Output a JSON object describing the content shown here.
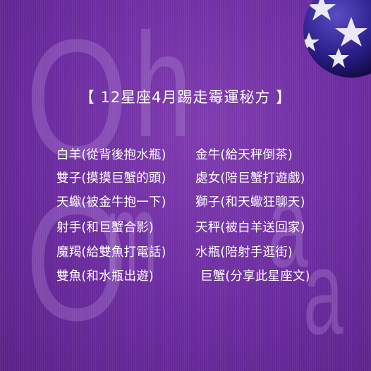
{
  "title": "【 12星座4月踢走霉運秘方 】",
  "watermark": {
    "letters": [
      "O",
      "h",
      "O",
      "m",
      "a",
      "a"
    ]
  },
  "ball": {
    "colors": [
      "#2b1f8a",
      "#e9e6f5"
    ]
  },
  "signs": [
    {
      "text": "白羊(從背後抱水瓶)"
    },
    {
      "text": "金牛(給天秤倒茶)"
    },
    {
      "text": "雙子(摸摸巨蟹的頭)"
    },
    {
      "text": "處女(陪巨蟹打遊戲)"
    },
    {
      "text": "天蠍(被金牛抱一下)"
    },
    {
      "text": "獅子(和天蠍狂聊天)"
    },
    {
      "text": "射手(和巨蟹合影)"
    },
    {
      "text": "天秤(被白羊送回家)"
    },
    {
      "text": "魔羯(給雙魚打電話)"
    },
    {
      "text": "水瓶(陪射手逛街)"
    },
    {
      "text": "雙魚(和水瓶出遊)"
    },
    {
      "text": "巨蟹(分享此星座文)"
    }
  ]
}
